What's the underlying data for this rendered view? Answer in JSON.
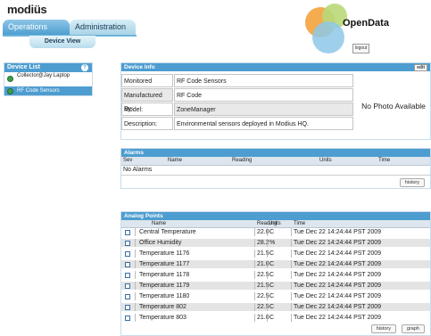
{
  "header": {
    "logo_main": "modiüs",
    "tabs": [
      {
        "label": "Operations"
      },
      {
        "label": "Administration"
      }
    ],
    "subtab": "Device View",
    "brand": "OpenData",
    "logout_label": "logout"
  },
  "device_list": {
    "title": "Device List",
    "items": [
      {
        "label": "Collector@Jay Laptop",
        "status": "green"
      },
      {
        "label": "RF Code Sensors",
        "status": "green",
        "selected": true
      }
    ]
  },
  "device_info": {
    "title": "Device Info",
    "edit_label": "edit",
    "rows": [
      {
        "label": "Monitored Device:",
        "value": "RF Code Sensors"
      },
      {
        "label": "Manufactured By:",
        "value": "RF Code"
      },
      {
        "label": "Model:",
        "value": "ZoneManager"
      },
      {
        "label": "Description:",
        "value": "Environmental sensors deployed in Modius HQ."
      }
    ],
    "photo_text": "No Photo Available"
  },
  "alarms": {
    "title": "Alarms",
    "columns": [
      "Sev",
      "Name",
      "Reading",
      "Units",
      "Time"
    ],
    "empty_text": "No Alarms",
    "history_label": "history"
  },
  "analog_points": {
    "title": "Analog Points",
    "columns": [
      "Name",
      "Reading",
      "Units",
      "Time"
    ],
    "rows": [
      {
        "name": "Central Temperature",
        "reading": "22.0",
        "units": "C",
        "time": "Tue Dec 22 14:24:44 PST 2009"
      },
      {
        "name": "Office Humidity",
        "reading": "28.2",
        "units": "%",
        "time": "Tue Dec 22 14:24:44 PST 2009"
      },
      {
        "name": "Temperature 1176",
        "reading": "21.5",
        "units": "C",
        "time": "Tue Dec 22 14:24:44 PST 2009"
      },
      {
        "name": "Temperature 1177",
        "reading": "21.0",
        "units": "C",
        "time": "Tue Dec 22 14:24:44 PST 2009"
      },
      {
        "name": "Temperature 1178",
        "reading": "22.5",
        "units": "C",
        "time": "Tue Dec 22 14:24:44 PST 2009"
      },
      {
        "name": "Temperature 1179",
        "reading": "21.5",
        "units": "C",
        "time": "Tue Dec 22 14:24:44 PST 2009"
      },
      {
        "name": "Temperature 1180",
        "reading": "22.5",
        "units": "C",
        "time": "Tue Dec 22 14:24:44 PST 2009"
      },
      {
        "name": "Temperature 802",
        "reading": "22.5",
        "units": "C",
        "time": "Tue Dec 22 14:24:44 PST 2009"
      },
      {
        "name": "Temperature 803",
        "reading": "21.0",
        "units": "C",
        "time": "Tue Dec 22 14:24:44 PST 2009"
      }
    ],
    "history_label": "history",
    "graph_label": "graph"
  },
  "colors": {
    "accent": "#4d9dd0",
    "status_ok": "#3aa14a",
    "row_alt": "#e4e4e4"
  }
}
